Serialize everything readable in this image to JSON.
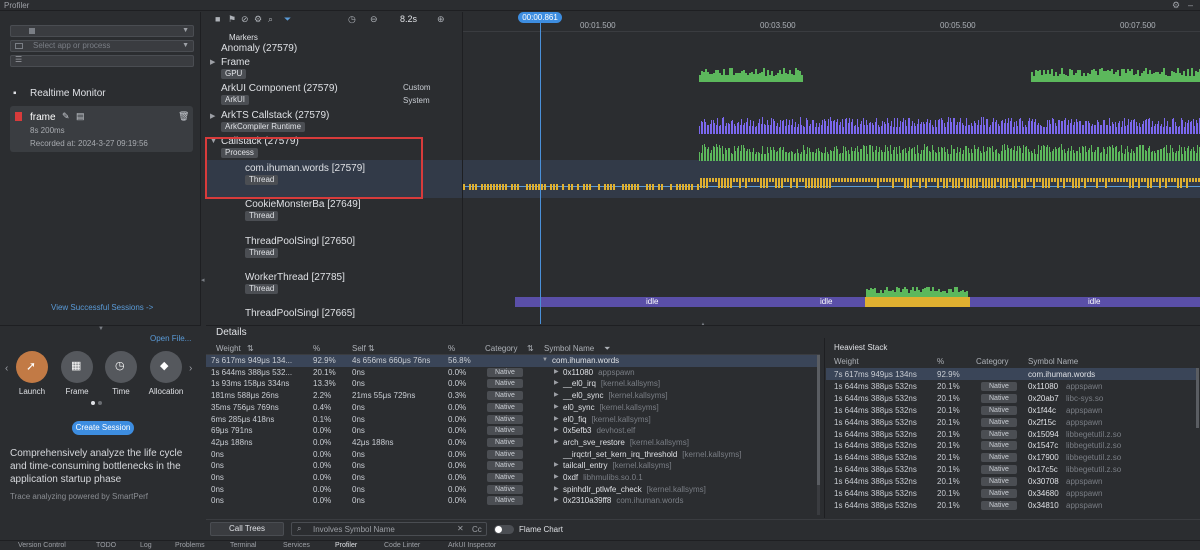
{
  "titlebar": {
    "title": "Profiler"
  },
  "left": {
    "select_placeholder": "Select app or process",
    "realtime_title": "Realtime Monitor",
    "session": {
      "name": "frame",
      "duration": "8s 200ms",
      "recorded": "Recorded at: 2024-3-27 09:19:56"
    },
    "view_sessions": "View Successful Sessions ->",
    "open_file": "Open File...",
    "options": [
      {
        "label": "Launch"
      },
      {
        "label": "Frame"
      },
      {
        "label": "Time"
      },
      {
        "label": "Allocation"
      }
    ],
    "create_session": "Create Session",
    "description": "Comprehensively analyze the life cycle and time-consuming bottlenecks in the application startup phase",
    "powered": "Trace analyzing powered by SmartPerf"
  },
  "timeline": {
    "duration": "8.2s",
    "cursor": "00:00.861",
    "ticks": [
      "00:01.500",
      "00:03.500",
      "00:05.500",
      "00:07.500"
    ],
    "markers_label": "Markers",
    "tracks": [
      {
        "name": "Anomaly (27579)",
        "tag": ""
      },
      {
        "name": "Frame",
        "tag": "GPU"
      },
      {
        "name": "ArkUI Component (27579)",
        "tag": "ArkUI",
        "extra1": "Custom",
        "extra2": "System"
      },
      {
        "name": "ArkTS Callstack (27579)",
        "tag": "ArkCompiler Runtime"
      },
      {
        "name": "Callstack (27579)",
        "tag": "Process"
      },
      {
        "name": "com.ihuman.words [27579]",
        "tag": "Thread"
      },
      {
        "name": "CookieMonsterBa [27649]",
        "tag": "Thread"
      },
      {
        "name": "ThreadPoolSingl [27650]",
        "tag": "Thread"
      },
      {
        "name": "WorkerThread [27785]",
        "tag": "Thread"
      },
      {
        "name": "ThreadPoolSingl [27665]",
        "tag": ""
      }
    ],
    "idle": [
      "idle",
      "idle",
      "idle"
    ]
  },
  "details": {
    "title": "Details",
    "headers": {
      "weight": "Weight",
      "pct": "%",
      "self": "Self",
      "pct2": "%",
      "category": "Category",
      "symbol": "Symbol Name"
    },
    "rows": [
      {
        "weight": "7s 617ms 949μs 134...",
        "pct": "92.9%",
        "self": "4s 656ms 660μs 76ns",
        "pct2": "56.8%",
        "cat": "",
        "sym": "com.ihuman.words",
        "lib": ""
      },
      {
        "weight": "1s 644ms 388μs 532...",
        "pct": "20.1%",
        "self": "0ns",
        "pct2": "0.0%",
        "cat": "Native",
        "sym": "0x11080",
        "lib": "appspawn"
      },
      {
        "weight": "1s 93ms 158μs 334ns",
        "pct": "13.3%",
        "self": "0ns",
        "pct2": "0.0%",
        "cat": "Native",
        "sym": "__el0_irq",
        "lib": "[kernel.kallsyms]"
      },
      {
        "weight": "181ms 588μs 26ns",
        "pct": "2.2%",
        "self": "21ms 55μs 729ns",
        "pct2": "0.3%",
        "cat": "Native",
        "sym": "__el0_sync",
        "lib": "[kernel.kallsyms]"
      },
      {
        "weight": "35ms 756μs 769ns",
        "pct": "0.4%",
        "self": "0ns",
        "pct2": "0.0%",
        "cat": "Native",
        "sym": "el0_sync",
        "lib": "[kernel.kallsyms]"
      },
      {
        "weight": "6ms 285μs 418ns",
        "pct": "0.1%",
        "self": "0ns",
        "pct2": "0.0%",
        "cat": "Native",
        "sym": "el0_fiq",
        "lib": "[kernel.kallsyms]"
      },
      {
        "weight": "69μs 791ns",
        "pct": "0.0%",
        "self": "0ns",
        "pct2": "0.0%",
        "cat": "Native",
        "sym": "0x5efb3",
        "lib": "devhost.elf"
      },
      {
        "weight": "42μs 188ns",
        "pct": "0.0%",
        "self": "42μs 188ns",
        "pct2": "0.0%",
        "cat": "Native",
        "sym": "arch_sve_restore",
        "lib": "[kernel.kallsyms]"
      },
      {
        "weight": "0ns",
        "pct": "0.0%",
        "self": "0ns",
        "pct2": "0.0%",
        "cat": "Native",
        "sym": "__irqctrl_set_kern_irq_threshold",
        "lib": "[kernel.kallsyms]"
      },
      {
        "weight": "0ns",
        "pct": "0.0%",
        "self": "0ns",
        "pct2": "0.0%",
        "cat": "Native",
        "sym": "tailcall_entry",
        "lib": "[kernel.kallsyms]"
      },
      {
        "weight": "0ns",
        "pct": "0.0%",
        "self": "0ns",
        "pct2": "0.0%",
        "cat": "Native",
        "sym": "0xdf",
        "lib": "libhmulibs.so.0.1"
      },
      {
        "weight": "0ns",
        "pct": "0.0%",
        "self": "0ns",
        "pct2": "0.0%",
        "cat": "Native",
        "sym": "spinhdlr_ptlwfe_check",
        "lib": "[kernel.kallsyms]"
      },
      {
        "weight": "0ns",
        "pct": "0.0%",
        "self": "0ns",
        "pct2": "0.0%",
        "cat": "Native",
        "sym": "0x2310a39ff8",
        "lib": "com.ihuman.words"
      }
    ],
    "heaviest": {
      "title": "Heaviest Stack",
      "headers": {
        "weight": "Weight",
        "pct": "%",
        "category": "Category",
        "symbol": "Symbol Name"
      },
      "rows": [
        {
          "weight": "7s 617ms 949μs 134ns",
          "pct": "92.9%",
          "cat": "",
          "sym": "com.ihuman.words",
          "lib": ""
        },
        {
          "weight": "1s 644ms 388μs 532ns",
          "pct": "20.1%",
          "cat": "Native",
          "sym": "0x11080",
          "lib": "appspawn"
        },
        {
          "weight": "1s 644ms 388μs 532ns",
          "pct": "20.1%",
          "cat": "Native",
          "sym": "0x20ab7",
          "lib": "libc-sys.so"
        },
        {
          "weight": "1s 644ms 388μs 532ns",
          "pct": "20.1%",
          "cat": "Native",
          "sym": "0x1f44c",
          "lib": "appspawn"
        },
        {
          "weight": "1s 644ms 388μs 532ns",
          "pct": "20.1%",
          "cat": "Native",
          "sym": "0x2f15c",
          "lib": "appspawn"
        },
        {
          "weight": "1s 644ms 388μs 532ns",
          "pct": "20.1%",
          "cat": "Native",
          "sym": "0x15094",
          "lib": "libbegetutil.z.so"
        },
        {
          "weight": "1s 644ms 388μs 532ns",
          "pct": "20.1%",
          "cat": "Native",
          "sym": "0x1547c",
          "lib": "libbegetutil.z.so"
        },
        {
          "weight": "1s 644ms 388μs 532ns",
          "pct": "20.1%",
          "cat": "Native",
          "sym": "0x17900",
          "lib": "libbegetutil.z.so"
        },
        {
          "weight": "1s 644ms 388μs 532ns",
          "pct": "20.1%",
          "cat": "Native",
          "sym": "0x17c5c",
          "lib": "libbegetutil.z.so"
        },
        {
          "weight": "1s 644ms 388μs 532ns",
          "pct": "20.1%",
          "cat": "Native",
          "sym": "0x30708",
          "lib": "appspawn"
        },
        {
          "weight": "1s 644ms 388μs 532ns",
          "pct": "20.1%",
          "cat": "Native",
          "sym": "0x34680",
          "lib": "appspawn"
        },
        {
          "weight": "1s 644ms 388μs 532ns",
          "pct": "20.1%",
          "cat": "Native",
          "sym": "0x34810",
          "lib": "appspawn"
        }
      ]
    },
    "call_trees": "Call Trees",
    "search_placeholder": "Involves Symbol Name",
    "flame_chart": "Flame Chart",
    "cc": "Cc"
  },
  "statusbar": [
    "Version Control",
    "TODO",
    "Log",
    "Problems",
    "Terminal",
    "Services",
    "Profiler",
    "Code Linter",
    "ArkUI Inspector"
  ],
  "colors": {
    "accent": "#3d8de0",
    "green": "#5cb85c",
    "purple": "#7b68ee",
    "yellow": "#e0b030",
    "red": "#d83b3b"
  }
}
